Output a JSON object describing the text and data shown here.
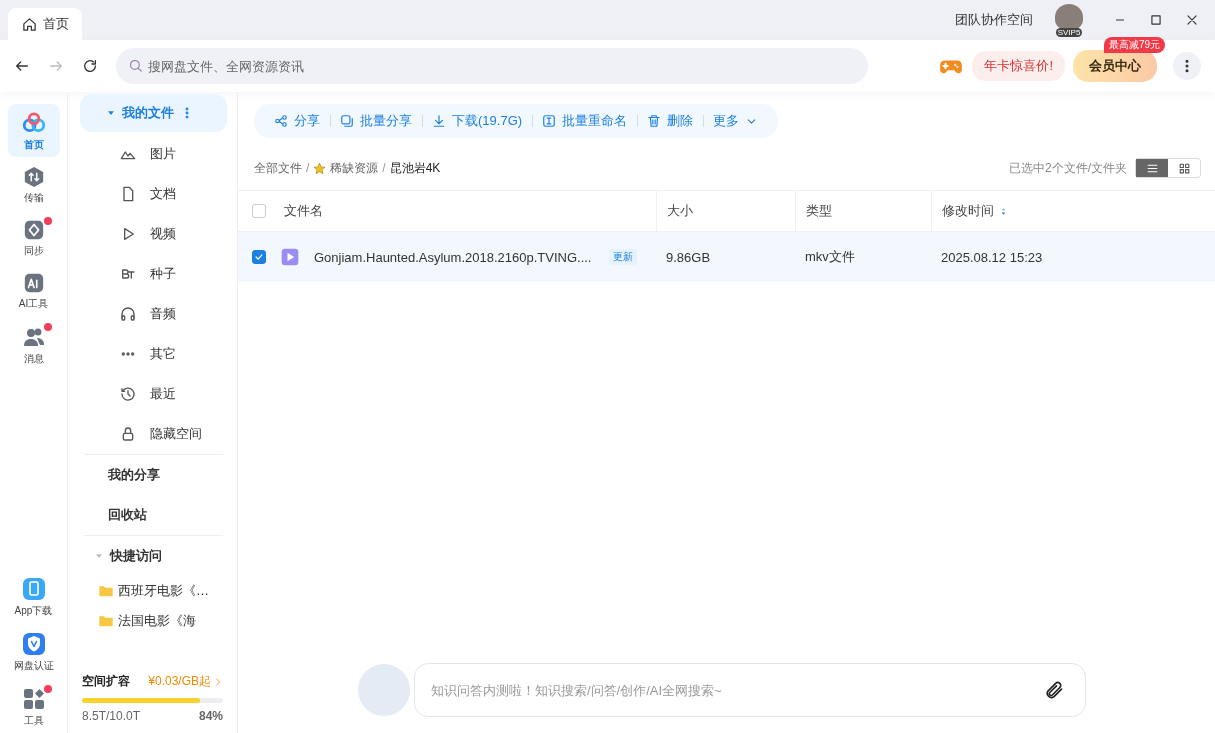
{
  "tabs": [
    {
      "label": "首页",
      "selected": true
    }
  ],
  "header": {
    "team_space": "团队协作空间",
    "avatar_badge": "SVIP5"
  },
  "search": {
    "placeholder": "搜网盘文件、全网资源资讯"
  },
  "promo": {
    "label": "年卡惊喜价!",
    "vip_button": "会员中心",
    "vip_badge": "最高减79元"
  },
  "rail": {
    "items": [
      {
        "label": "首页",
        "kind": "home",
        "selected": true,
        "badge": false
      },
      {
        "label": "传输",
        "kind": "transfer",
        "selected": false,
        "badge": false
      },
      {
        "label": "同步",
        "kind": "sync",
        "selected": false,
        "badge": true
      },
      {
        "label": "AI工具",
        "kind": "ai",
        "selected": false,
        "badge": false
      },
      {
        "label": "消息",
        "kind": "message",
        "selected": false,
        "badge": true
      }
    ],
    "bottom_items": [
      {
        "label": "App下载",
        "kind": "phone",
        "badge": false
      },
      {
        "label": "网盘认证",
        "kind": "shield",
        "badge": false
      },
      {
        "label": "工具",
        "kind": "grid",
        "badge": true
      }
    ]
  },
  "sidebar": {
    "my_files": {
      "label": "我的文件",
      "selected": true
    },
    "categories": [
      {
        "label": "图片",
        "kind": "image"
      },
      {
        "label": "文档",
        "kind": "doc"
      },
      {
        "label": "视频",
        "kind": "video"
      },
      {
        "label": "种子",
        "kind": "bt"
      },
      {
        "label": "音频",
        "kind": "audio"
      },
      {
        "label": "其它",
        "kind": "other"
      },
      {
        "label": "最近",
        "kind": "recent"
      },
      {
        "label": "隐藏空间",
        "kind": "lock"
      }
    ],
    "links": [
      "我的分享",
      "回收站"
    ],
    "quick_access": {
      "label": "快捷访问",
      "expanded": true,
      "items": [
        "西班牙电影《…",
        "法国电影《海"
      ]
    },
    "storage": {
      "title": "空间扩容",
      "price": "¥0.03/GB起",
      "level": 0.84,
      "used": "8.5T/10.0T",
      "percent": "84%"
    }
  },
  "toolbar": {
    "actions": [
      {
        "label": "分享",
        "kind": "share"
      },
      {
        "label": "批量分享",
        "kind": "batch-share"
      },
      {
        "label": "下载(19.7G)",
        "kind": "download"
      },
      {
        "label": "批量重命名",
        "kind": "rename"
      },
      {
        "label": "删除",
        "kind": "delete"
      },
      {
        "label": "更多",
        "kind": "more"
      }
    ]
  },
  "breadcrumb_separator": "/",
  "breadcrumb": [
    {
      "label": "全部文件",
      "starred": false
    },
    {
      "label": "稀缺资源",
      "starred": true
    },
    {
      "label": "昆池岩4K",
      "starred": false
    }
  ],
  "selection_info": "已选中2个文件/文件夹",
  "view_modes": [
    {
      "kind": "list",
      "selected": true
    },
    {
      "kind": "grid",
      "selected": false
    }
  ],
  "table": {
    "all_checked": false,
    "columns": [
      "文件名",
      "大小",
      "类型",
      "修改时间"
    ],
    "rows": [
      {
        "name": "Gonjiam.Haunted.Asylum.2018.2160p.TVING....",
        "tag": "更新",
        "size": "9.86GB",
        "type": "mkv文件",
        "modified": "2025.08.12 15:23",
        "checked": true
      }
    ]
  },
  "assistant": {
    "placeholder": "知识问答内测啦！知识搜索/问答/创作/AI全网搜索~"
  }
}
